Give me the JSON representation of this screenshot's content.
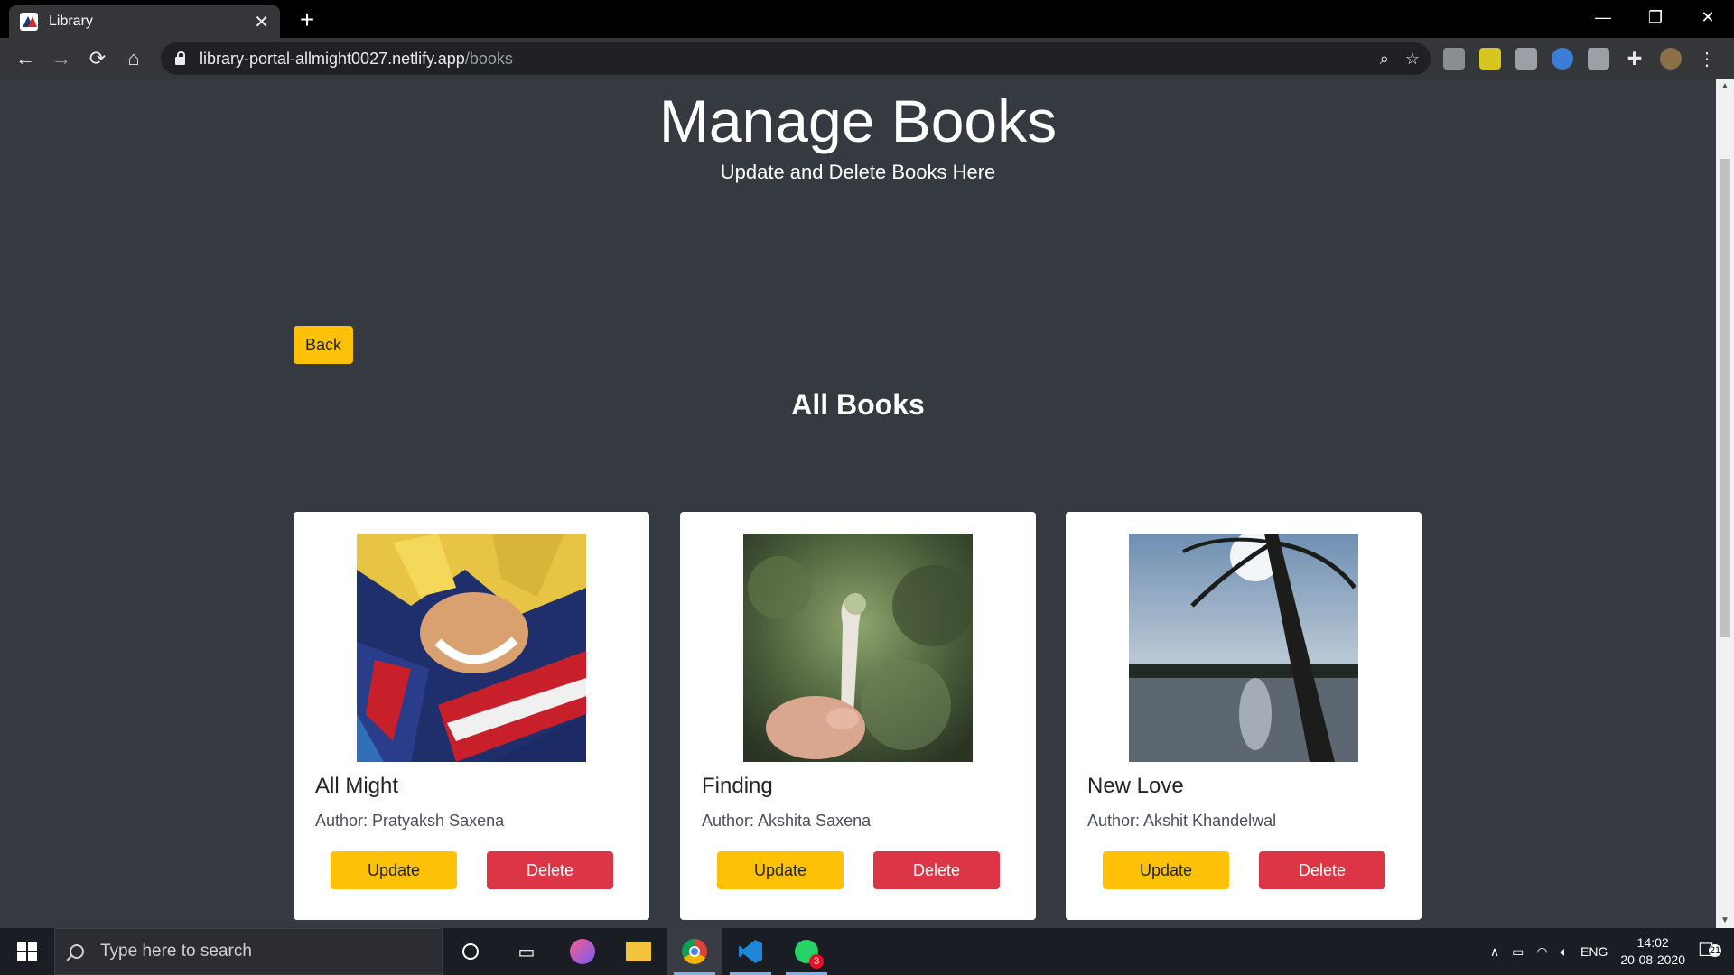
{
  "browser": {
    "tab_title": "Library",
    "url_host": "library-portal-allmight0027.netlify.app",
    "url_path": "/books"
  },
  "page": {
    "title": "Manage Books",
    "subtitle": "Update and Delete Books Here",
    "back_label": "Back",
    "section_title": "All Books",
    "books": [
      {
        "title": "All Might",
        "author": "Author: Pratyaksh Saxena",
        "update_label": "Update",
        "delete_label": "Delete"
      },
      {
        "title": "Finding",
        "author": "Author: Akshita Saxena",
        "update_label": "Update",
        "delete_label": "Delete"
      },
      {
        "title": "New Love",
        "author": "Author: Akshit Khandelwal",
        "update_label": "Update",
        "delete_label": "Delete"
      }
    ]
  },
  "taskbar": {
    "search_placeholder": "Type here to search",
    "language": "ENG",
    "time": "14:02",
    "date": "20-08-2020",
    "notification_count": "21",
    "whatsapp_badge": "3"
  },
  "colors": {
    "page_bg": "#343a40",
    "warning": "#ffc107",
    "danger": "#dc3545"
  }
}
